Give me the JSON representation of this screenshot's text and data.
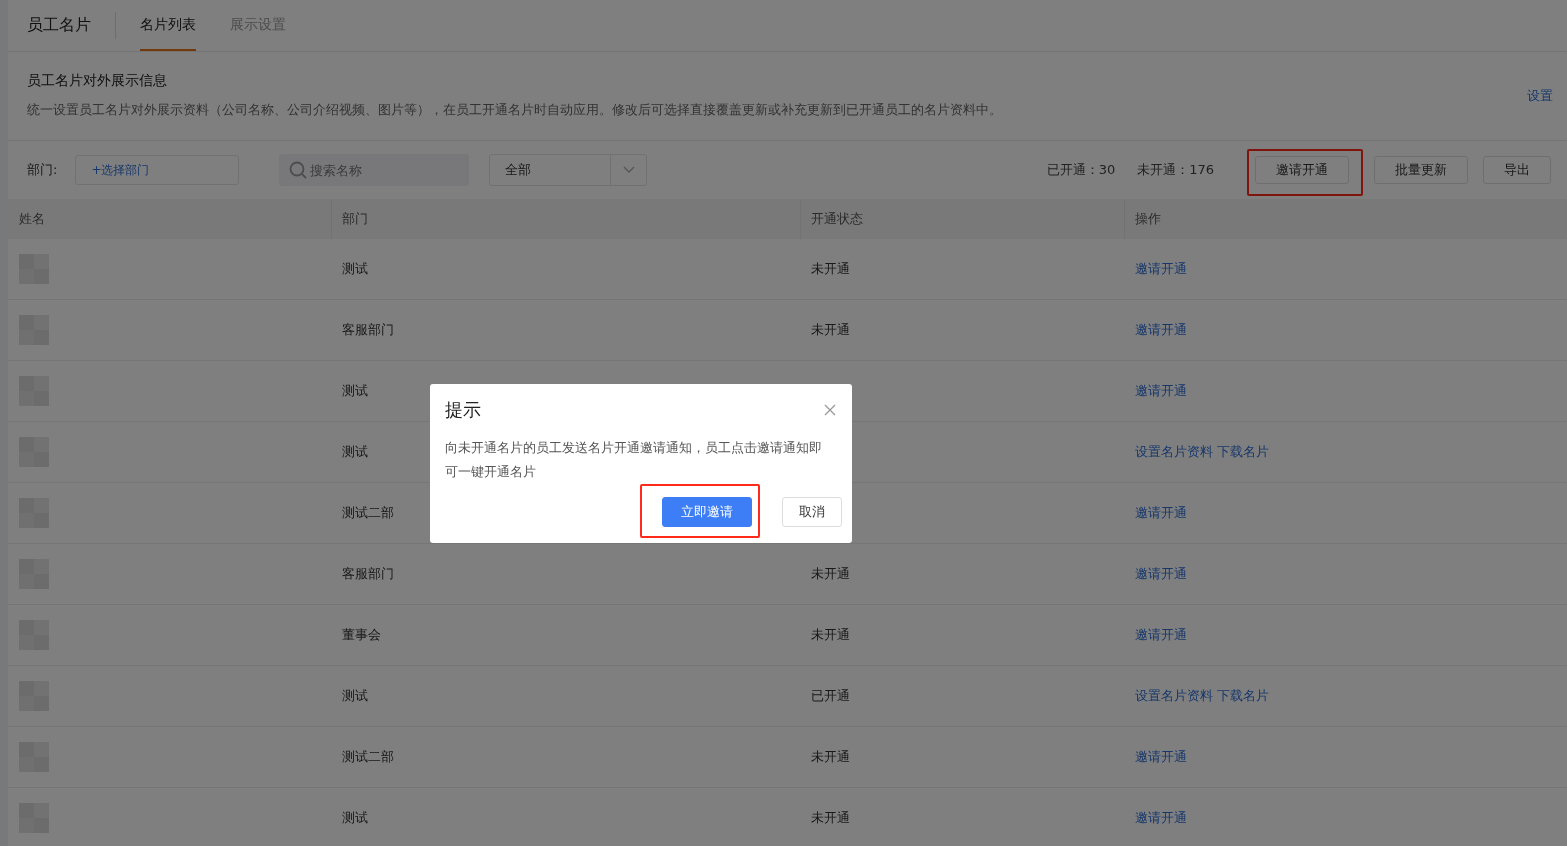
{
  "header": {
    "title": "员工名片",
    "tabs": [
      {
        "label": "名片列表",
        "selected": true
      },
      {
        "label": "展示设置",
        "selected": false
      }
    ]
  },
  "info": {
    "title": "员工名片对外展示信息",
    "description": "统一设置员工名片对外展示资料（公司名称、公司介绍视频、图片等），在员工开通名片时自动应用。修改后可选择直接覆盖更新或补充更新到已开通员工的名片资料中。",
    "link": "设置"
  },
  "toolbar": {
    "dept_label": "部门:",
    "dept_picker": "+选择部门",
    "search_placeholder": "搜索名称",
    "status_select": "全部",
    "opened": "已开通：30",
    "unopened": "未开通：176",
    "buttons": [
      {
        "label": "邀请开通",
        "highlighted": true
      },
      {
        "label": "批量更新",
        "highlighted": false
      },
      {
        "label": "导出",
        "highlighted": false
      }
    ]
  },
  "table": {
    "columns": [
      "姓名",
      "部门",
      "开通状态",
      "操作"
    ],
    "rows": [
      {
        "dept": "测试",
        "status": "未开通",
        "actions": [
          "邀请开通"
        ]
      },
      {
        "dept": "客服部门",
        "status": "未开通",
        "actions": [
          "邀请开通"
        ]
      },
      {
        "dept": "测试",
        "actions": [
          "邀请开通"
        ]
      },
      {
        "dept": "测试",
        "actions": [
          "设置名片资料",
          "下载名片"
        ]
      },
      {
        "dept": "测试二部",
        "actions": [
          "邀请开通"
        ]
      },
      {
        "dept": "客服部门",
        "status": "未开通",
        "actions": [
          "邀请开通"
        ]
      },
      {
        "dept": "董事会",
        "status": "未开通",
        "actions": [
          "邀请开通"
        ]
      },
      {
        "dept": "测试",
        "status": "已开通",
        "actions": [
          "设置名片资料",
          "下载名片"
        ]
      },
      {
        "dept": "测试二部",
        "status": "未开通",
        "actions": [
          "邀请开通"
        ]
      },
      {
        "dept": "测试",
        "status": "未开通",
        "actions": [
          "邀请开通"
        ]
      }
    ]
  },
  "dialog": {
    "title": "提示",
    "message": "向未开通名片的员工发送名片开通邀请通知，员工点击邀请通知即可一键开通名片",
    "buttons": [
      {
        "label": "立即邀请",
        "kind": "primary",
        "highlighted": true
      },
      {
        "label": "取消",
        "kind": "default",
        "highlighted": false
      }
    ]
  }
}
